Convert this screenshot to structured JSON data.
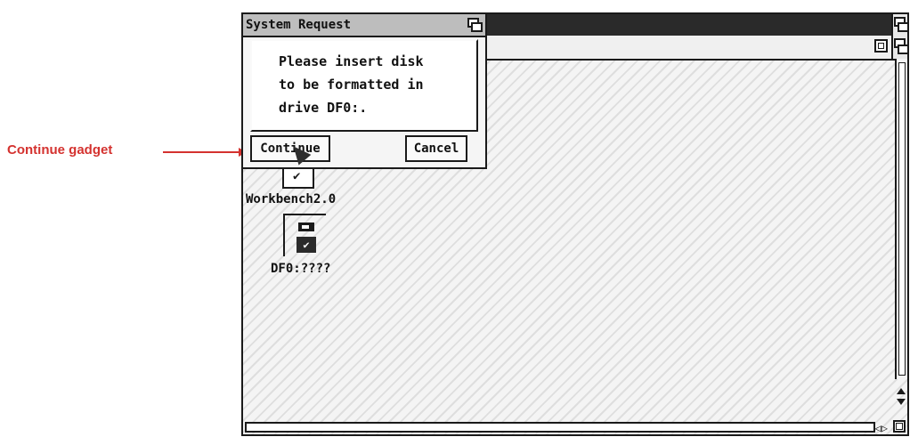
{
  "callout": {
    "label": "Continue gadget"
  },
  "request": {
    "title": "System Request",
    "message_lines": [
      "Please insert disk",
      "to be formatted in",
      "drive DF0:."
    ],
    "continue_label": "Continue",
    "cancel_label": "Cancel"
  },
  "icons": {
    "workbench_label": "Workbench2.0",
    "df0_label": "DF0:????"
  },
  "colors": {
    "callout": "#d4322f",
    "titlebar_dark": "#2a2a2a"
  }
}
